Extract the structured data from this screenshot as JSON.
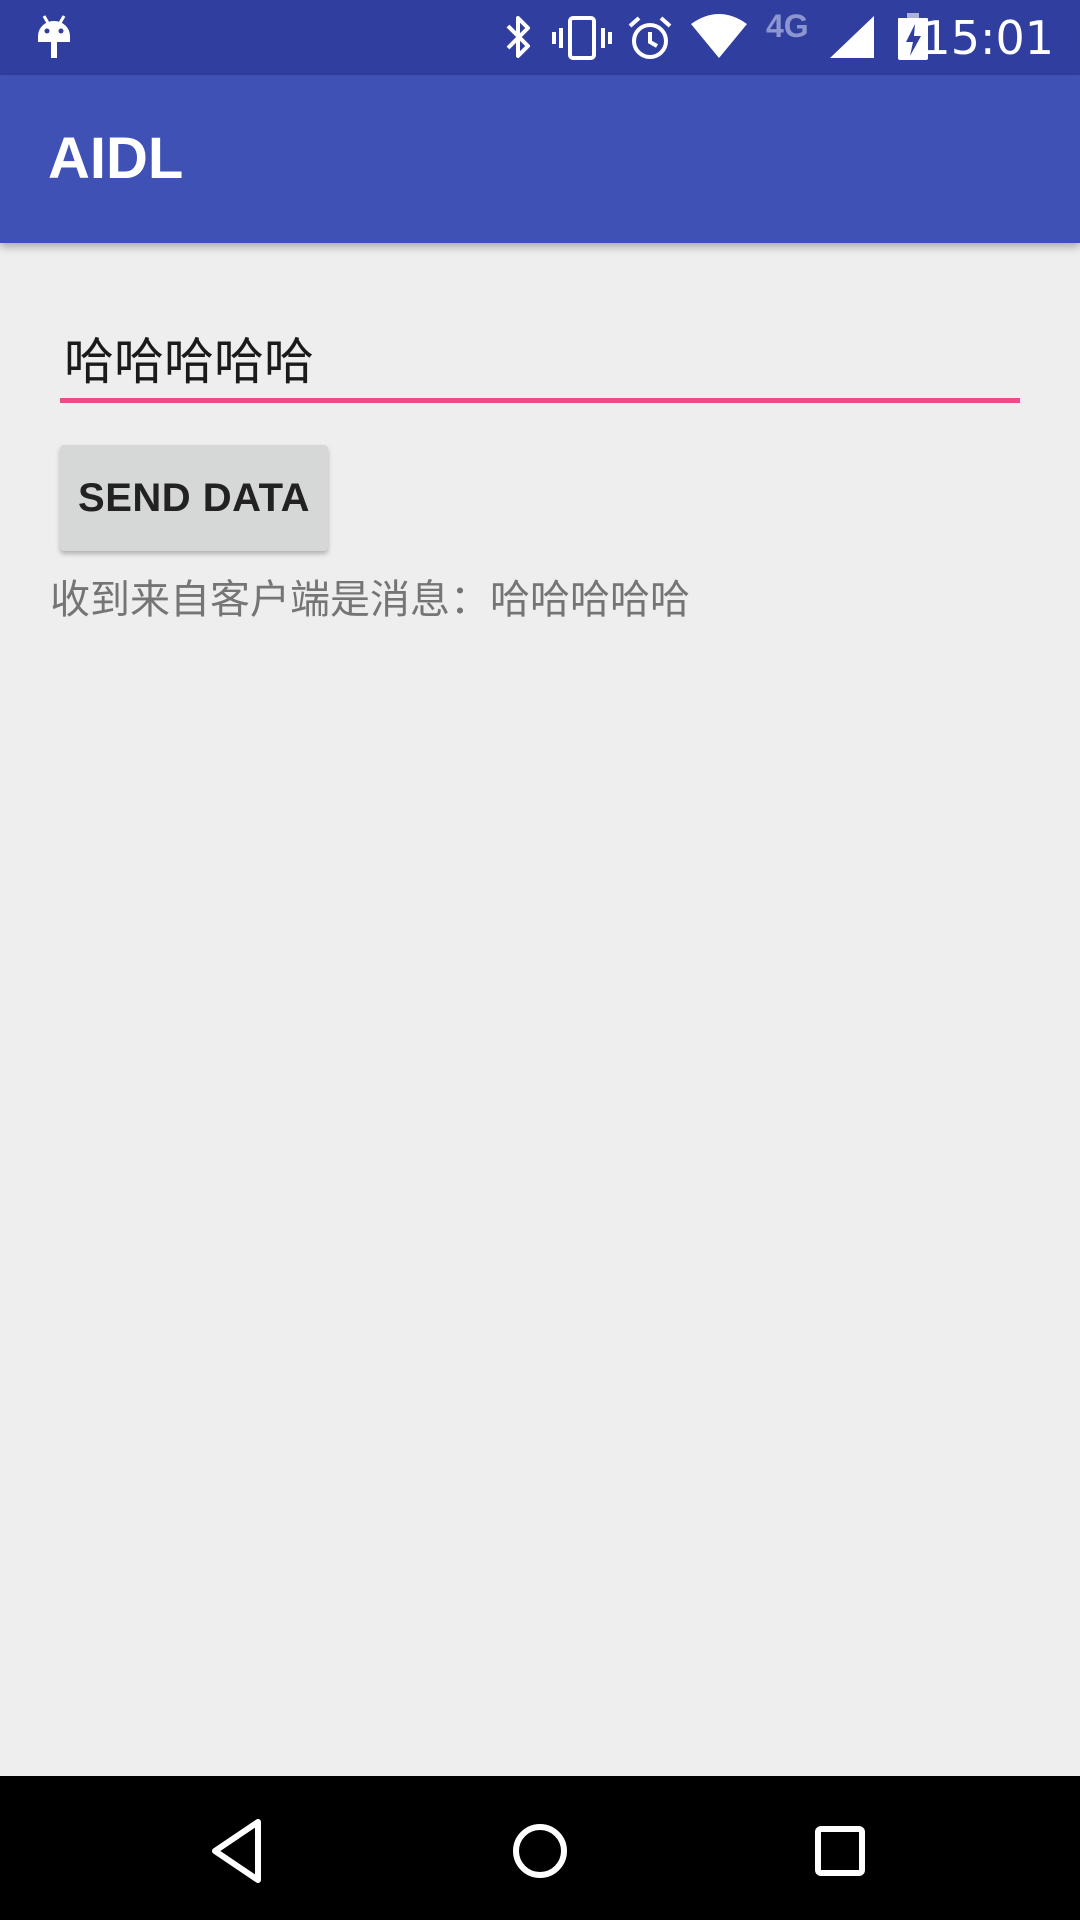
{
  "status_bar": {
    "time": "15:01",
    "network_label": "4G",
    "icons": [
      "android-debug-icon",
      "bluetooth-icon",
      "vibrate-icon",
      "alarm-icon",
      "wifi-icon",
      "cell-signal-icon",
      "battery-charging-icon"
    ]
  },
  "toolbar": {
    "title": "AIDL"
  },
  "form": {
    "input_value": "哈哈哈哈哈",
    "send_button_label": "SEND DATA",
    "received_message": "收到来自客户端是消息：哈哈哈哈哈"
  },
  "navigation": {
    "icons": [
      "back-icon",
      "home-icon",
      "recents-icon"
    ]
  },
  "colors": {
    "status_bar": "#303F9F",
    "toolbar": "#3F51B5",
    "accent": "#E94C86",
    "background": "#EEEEEE"
  }
}
